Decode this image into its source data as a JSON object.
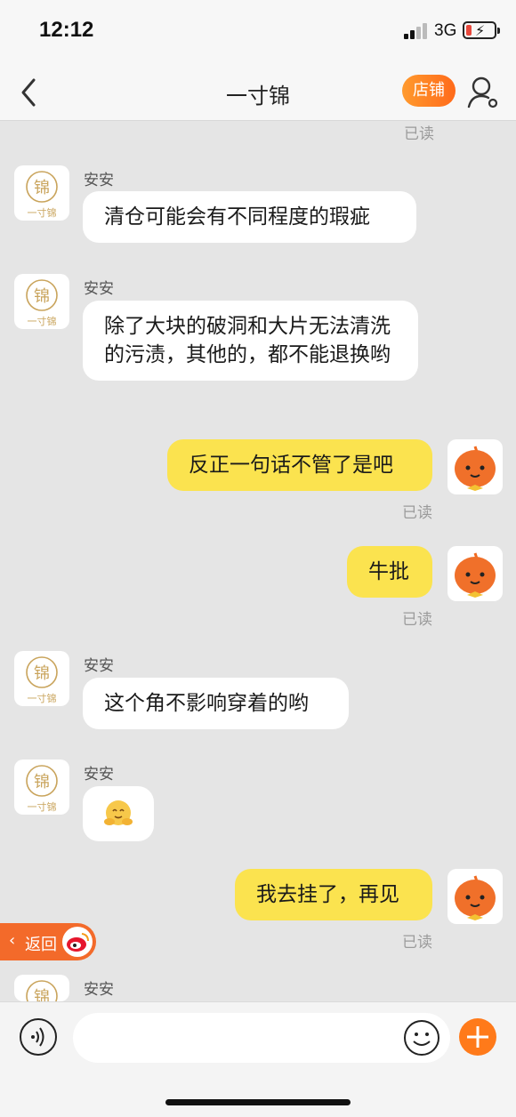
{
  "status_bar": {
    "time": "12:12",
    "network": "3G"
  },
  "nav": {
    "title": "一寸锦",
    "shop_label": "店铺"
  },
  "read_label": "已读",
  "messages": [
    {
      "from": "shop",
      "sender": "安安",
      "text": "清仓可能会有不同程度的瑕疵"
    },
    {
      "from": "shop",
      "sender": "安安",
      "text": "除了大块的破洞和大片无法清洗的污渍，其他的，都不能退换哟"
    },
    {
      "from": "me",
      "text": "反正一句话不管了是吧",
      "status": "已读"
    },
    {
      "from": "me",
      "text": "牛批",
      "status": "已读"
    },
    {
      "from": "shop",
      "sender": "安安",
      "text": "这个角不影响穿着的哟"
    },
    {
      "from": "shop",
      "sender": "安安",
      "sticker": "hugging-face-icon"
    },
    {
      "from": "me",
      "text": "我去挂了，再见",
      "status": "已读"
    },
    {
      "from": "shop",
      "sender": "安安"
    }
  ],
  "return_pill": {
    "label": "返回"
  },
  "input_bar": {
    "placeholder": ""
  },
  "colors": {
    "accent": "#ff7a1a",
    "out_bubble": "#fbe34f",
    "in_bubble": "#ffffff"
  }
}
